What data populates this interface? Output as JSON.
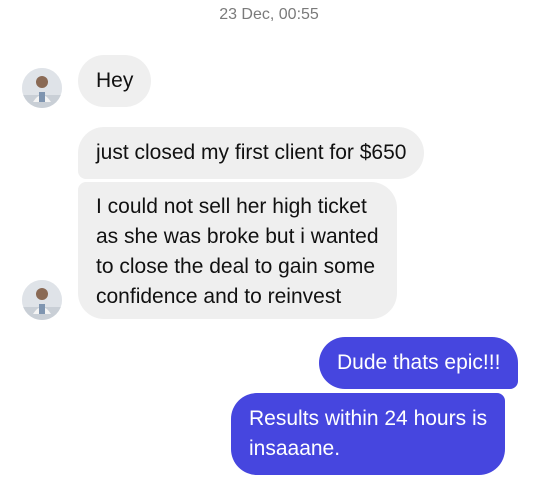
{
  "chat": {
    "timestamp": "23 Dec, 00:55",
    "messages": [
      {
        "sender": "contact",
        "lines": [
          "Hey"
        ]
      },
      {
        "sender": "contact",
        "lines": [
          "just closed my first client for $650"
        ]
      },
      {
        "sender": "contact",
        "lines": [
          "I could not sell her high ticket",
          "as she was broke but i wanted",
          "to close the deal to gain some",
          "confidence and to reinvest"
        ]
      },
      {
        "sender": "me",
        "lines": [
          "Dude thats epic!!!"
        ]
      },
      {
        "sender": "me",
        "lines": [
          "Results within 24 hours is",
          "insaaane."
        ]
      }
    ]
  },
  "colors": {
    "incoming_bubble": "#efefef",
    "outgoing_bubble": "#4646df",
    "timestamp_text": "#7a7a7a"
  }
}
